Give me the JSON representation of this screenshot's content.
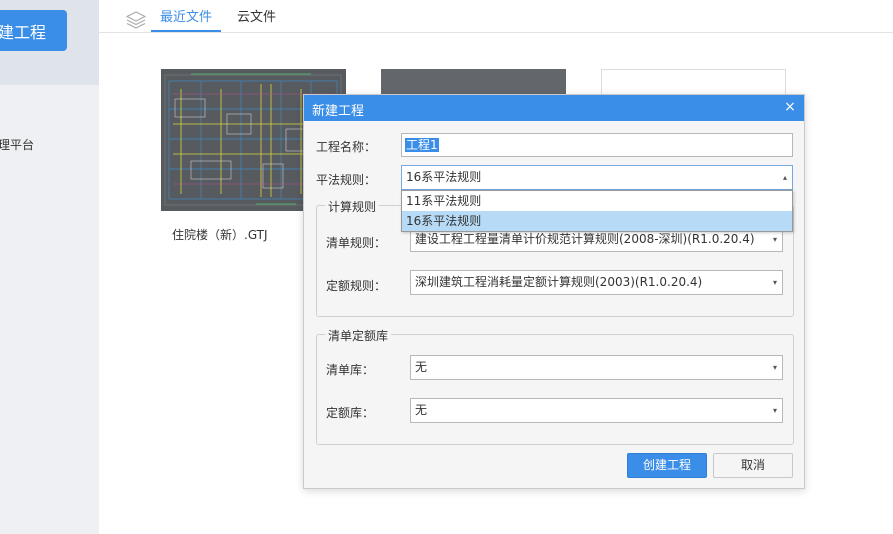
{
  "sidebar": {
    "new_project_label": "建工程",
    "platform_label": "理平台"
  },
  "tabs": [
    {
      "label": "最近文件",
      "active": true
    },
    {
      "label": "云文件",
      "active": false
    }
  ],
  "recent_files": [
    {
      "name": "住院楼（新）.GTJ"
    },
    {
      "name": ""
    },
    {
      "name": ""
    }
  ],
  "dialog": {
    "title": "新建工程",
    "close_glyph": "×",
    "project_name": {
      "label": "工程名称：",
      "value": "工程1"
    },
    "pingfa_rule": {
      "label": "平法规则：",
      "value": "16系平法规则",
      "options": [
        "11系平法规则",
        "16系平法规则"
      ],
      "highlighted": "16系平法规则"
    },
    "calc_rules": {
      "legend": "计算规则",
      "bill_rule": {
        "label": "清单规则：",
        "value": "建设工程工程量清单计价规范计算规则(2008-深圳)(R1.0.20.4)"
      },
      "quota_rule": {
        "label": "定额规则：",
        "value": "深圳建筑工程消耗量定额计算规则(2003)(R1.0.20.4)"
      }
    },
    "library": {
      "legend": "清单定额库",
      "bill_lib": {
        "label": "清单库：",
        "value": "无"
      },
      "quota_lib": {
        "label": "定额库：",
        "value": "无"
      }
    },
    "create_button": "创建工程",
    "cancel_button": "取消"
  },
  "colors": {
    "accent": "#3b8ee8",
    "dropdown_highlight": "#b7dbf7"
  },
  "icons": {
    "layers": "layers-icon",
    "close": "close-icon",
    "dropdown_arrow": "▾",
    "dropdown_arrow_up": "▴"
  }
}
